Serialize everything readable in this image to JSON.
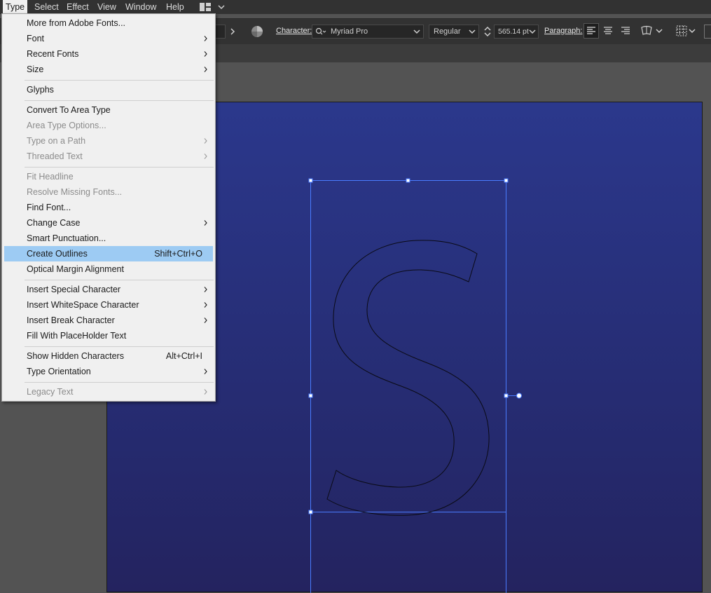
{
  "menubar": {
    "items": [
      "Type",
      "Select",
      "Effect",
      "View",
      "Window",
      "Help"
    ],
    "active": "Type"
  },
  "controlbar": {
    "character_label": "Character:",
    "font_name": "Myriad Pro",
    "font_style": "Regular",
    "font_size": "565.14 pt",
    "paragraph_label": "Paragraph:"
  },
  "type_menu": {
    "items": [
      {
        "label": "More from Adobe Fonts...",
        "enabled": true
      },
      {
        "label": "Font",
        "submenu": true,
        "enabled": true
      },
      {
        "label": "Recent Fonts",
        "submenu": true,
        "enabled": true
      },
      {
        "label": "Size",
        "submenu": true,
        "enabled": true
      },
      {
        "label": "Glyphs",
        "enabled": true
      },
      {
        "label": "Convert To Area Type",
        "enabled": true
      },
      {
        "label": "Area Type Options...",
        "enabled": false
      },
      {
        "label": "Type on a Path",
        "submenu": true,
        "enabled": false
      },
      {
        "label": "Threaded Text",
        "submenu": true,
        "enabled": false
      },
      {
        "label": "Fit Headline",
        "enabled": false
      },
      {
        "label": "Resolve Missing Fonts...",
        "enabled": false
      },
      {
        "label": "Find Font...",
        "enabled": true
      },
      {
        "label": "Change Case",
        "submenu": true,
        "enabled": true
      },
      {
        "label": "Smart Punctuation...",
        "enabled": true
      },
      {
        "label": "Create Outlines",
        "shortcut": "Shift+Ctrl+O",
        "enabled": true,
        "highlighted": true
      },
      {
        "label": "Optical Margin Alignment",
        "enabled": true
      },
      {
        "label": "Insert Special Character",
        "submenu": true,
        "enabled": true
      },
      {
        "label": "Insert WhiteSpace Character",
        "submenu": true,
        "enabled": true
      },
      {
        "label": "Insert Break Character",
        "submenu": true,
        "enabled": true
      },
      {
        "label": "Fill With PlaceHolder Text",
        "enabled": true
      },
      {
        "label": "Show Hidden Characters",
        "shortcut": "Alt+Ctrl+I",
        "enabled": true
      },
      {
        "label": "Type Orientation",
        "submenu": true,
        "enabled": true
      },
      {
        "label": "Legacy Text",
        "submenu": true,
        "enabled": false
      }
    ]
  },
  "colors": {
    "menu_bg": "#f0f0f0",
    "menu_highlight": "#9dcbf3",
    "selection": "#4a7cff",
    "artboard_top": "#2b388c",
    "artboard_bottom": "#24235f",
    "app_bg": "#535353"
  }
}
